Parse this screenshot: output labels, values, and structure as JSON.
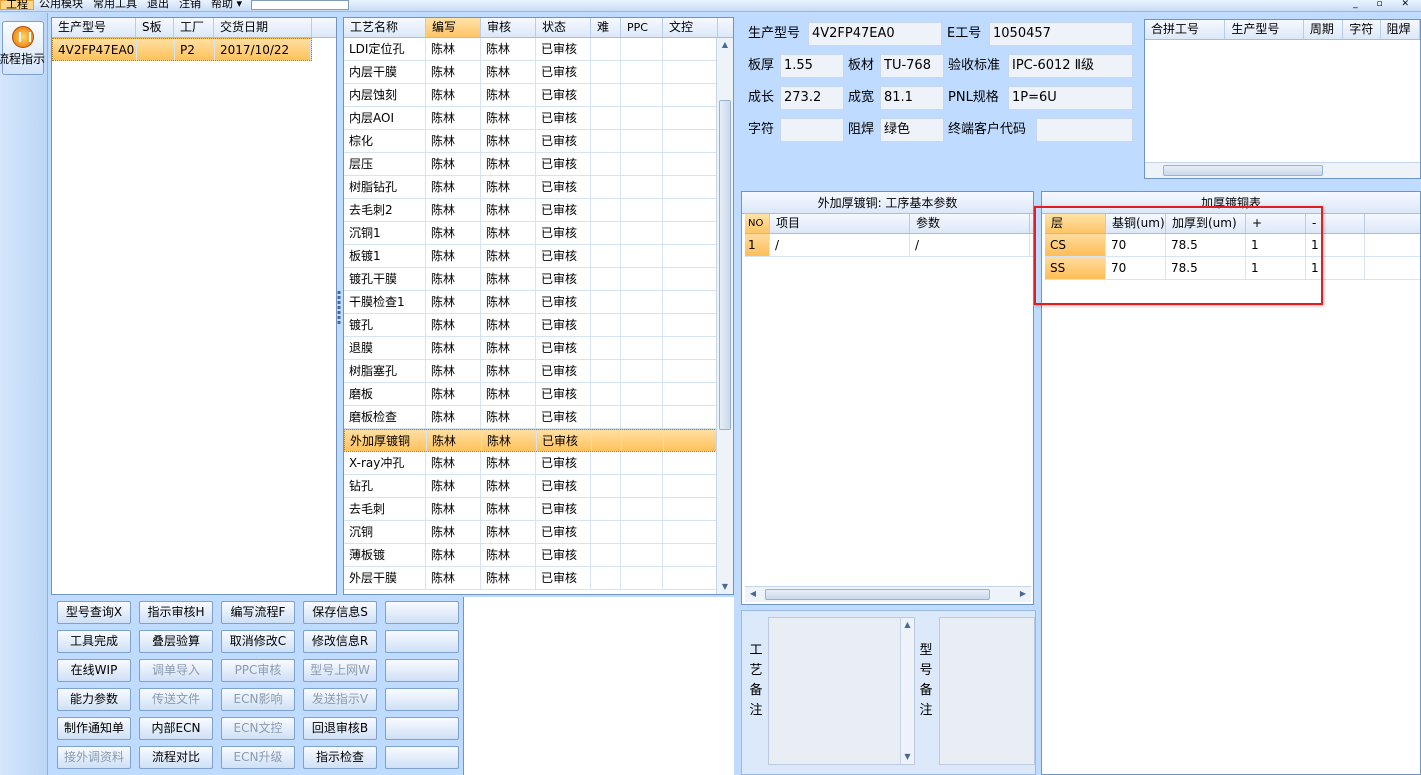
{
  "menu": {
    "items": [
      "工程",
      "公用模块",
      "常用工具",
      "退出",
      "注销",
      "帮助 ▾"
    ],
    "window_controls": "_ ▫ ✕"
  },
  "sidebar": {
    "flow_button_label": "流程指示"
  },
  "models_grid": {
    "columns": [
      "生产型号",
      "S板",
      "工厂",
      "交货日期"
    ],
    "rows": [
      {
        "model": "4V2FP47EA0",
        "s": "",
        "factory": "P2",
        "date": "2017/10/22"
      }
    ]
  },
  "process_grid": {
    "columns": [
      "工艺名称",
      "编写",
      "审核",
      "状态",
      "难",
      "PPC",
      "文控"
    ],
    "selected_index": 17,
    "rows": [
      [
        "LDI定位孔",
        "陈林",
        "陈林",
        "已审核"
      ],
      [
        "内层干膜",
        "陈林",
        "陈林",
        "已审核"
      ],
      [
        "内层蚀刻",
        "陈林",
        "陈林",
        "已审核"
      ],
      [
        "内层AOI",
        "陈林",
        "陈林",
        "已审核"
      ],
      [
        "棕化",
        "陈林",
        "陈林",
        "已审核"
      ],
      [
        "层压",
        "陈林",
        "陈林",
        "已审核"
      ],
      [
        "树脂钻孔",
        "陈林",
        "陈林",
        "已审核"
      ],
      [
        "去毛刺2",
        "陈林",
        "陈林",
        "已审核"
      ],
      [
        "沉铜1",
        "陈林",
        "陈林",
        "已审核"
      ],
      [
        "板镀1",
        "陈林",
        "陈林",
        "已审核"
      ],
      [
        "镀孔干膜",
        "陈林",
        "陈林",
        "已审核"
      ],
      [
        "干膜检查1",
        "陈林",
        "陈林",
        "已审核"
      ],
      [
        "镀孔",
        "陈林",
        "陈林",
        "已审核"
      ],
      [
        "退膜",
        "陈林",
        "陈林",
        "已审核"
      ],
      [
        "树脂塞孔",
        "陈林",
        "陈林",
        "已审核"
      ],
      [
        "磨板",
        "陈林",
        "陈林",
        "已审核"
      ],
      [
        "磨板检查",
        "陈林",
        "陈林",
        "已审核"
      ],
      [
        "外加厚镀铜",
        "陈林",
        "陈林",
        "已审核"
      ],
      [
        "X-ray冲孔",
        "陈林",
        "陈林",
        "已审核"
      ],
      [
        "钻孔",
        "陈林",
        "陈林",
        "已审核"
      ],
      [
        "去毛刺",
        "陈林",
        "陈林",
        "已审核"
      ],
      [
        "沉铜",
        "陈林",
        "陈林",
        "已审核"
      ],
      [
        "薄板镀",
        "陈林",
        "陈林",
        "已审核"
      ],
      [
        "外层干膜",
        "陈林",
        "陈林",
        "已审核"
      ]
    ]
  },
  "buttons": [
    [
      "型号查询X",
      "指示审核H",
      "编写流程F",
      "保存信息S",
      ""
    ],
    [
      "工具完成",
      "叠层验算",
      "取消修改C",
      "修改信息R",
      ""
    ],
    [
      "在线WIP",
      "调单导入",
      "PPC审核",
      "型号上网W",
      ""
    ],
    [
      "能力参数",
      "传送文件",
      "ECN影响",
      "发送指示V",
      ""
    ],
    [
      "制作通知单",
      "内部ECN",
      "ECN文控",
      "回退审核B",
      ""
    ],
    [
      "接外调资料",
      "流程对比",
      "ECN升级",
      "指示检查",
      ""
    ]
  ],
  "buttons_disabled": [
    [
      false,
      false,
      false,
      false,
      false
    ],
    [
      false,
      false,
      false,
      false,
      false
    ],
    [
      false,
      true,
      true,
      true,
      false
    ],
    [
      false,
      true,
      true,
      true,
      false
    ],
    [
      false,
      false,
      true,
      false,
      false
    ],
    [
      true,
      false,
      true,
      false,
      false
    ]
  ],
  "info": {
    "model_label": "生产型号",
    "model": "4V2FP47EA0",
    "ework_label": "E工号",
    "ework": "1050457",
    "thickness_label": "板厚",
    "thickness": "1.55",
    "material_label": "板材",
    "material": "TU-768",
    "standard_label": "验收标准",
    "standard": "IPC-6012 Ⅱ级",
    "length_label": "成长",
    "length": "273.2",
    "width_label": "成宽",
    "width": "81.1",
    "pnl_label": "PNL规格",
    "pnl": "1P=6U",
    "char_label": "字符",
    "char": "",
    "mask_label": "阻焊",
    "mask": "绿色",
    "customer_label": "终端客户代码",
    "customer": ""
  },
  "merge_grid": {
    "columns": [
      "合拼工号",
      "生产型号",
      "周期",
      "字符",
      "阻焊"
    ]
  },
  "params_panel": {
    "title": "外加厚镀铜: 工序基本参数",
    "columns": [
      "NO",
      "项目",
      "参数"
    ],
    "rows": [
      [
        "1",
        "/",
        "/"
      ]
    ]
  },
  "plating_panel": {
    "title": "加厚镀铜表",
    "columns": [
      "层",
      "基铜(um)",
      "加厚到(um)",
      "+",
      "-"
    ],
    "rows": [
      [
        "CS",
        "70",
        "78.5",
        "1",
        "1"
      ],
      [
        "SS",
        "70",
        "78.5",
        "1",
        "1"
      ]
    ]
  },
  "remarks": {
    "process": "工艺备注",
    "model": "型号备注"
  },
  "colors": {
    "highlight_box": "#e02020",
    "selection": "#ffc15a",
    "background": "#bfdbff"
  }
}
